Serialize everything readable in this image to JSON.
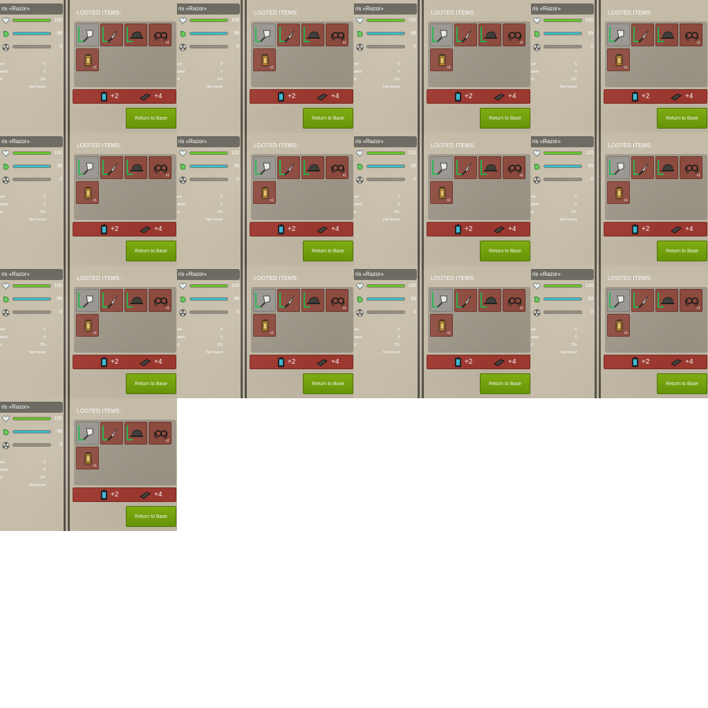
{
  "frames": 13,
  "character": {
    "name": "ris «Razor»",
    "stats": [
      {
        "icon": "heart-icon",
        "value": "100",
        "level": 1.0,
        "color": "#5fc41f"
      },
      {
        "icon": "stomach-icon",
        "value": "99",
        "level": 0.99,
        "color": "#2fb8c8"
      },
      {
        "icon": "radiation-icon",
        "value": "0",
        "level": 0.0,
        "color": "#9a9384"
      }
    ],
    "info": [
      {
        "label": "ed:",
        "value": "0"
      },
      {
        "label": "ated:",
        "value": "0"
      },
      {
        "label": "d:",
        "value": "2%"
      },
      {
        "label": ":",
        "value": "Not found"
      }
    ]
  },
  "loot": {
    "title": "LOOTED ITEMS:",
    "items": [
      {
        "icon": "cleaver-icon",
        "qty": "",
        "highlight": true,
        "new": true
      },
      {
        "icon": "knife-icon",
        "qty": "",
        "highlight": false,
        "new": true
      },
      {
        "icon": "cap-icon",
        "qty": "",
        "highlight": false,
        "new": true
      },
      {
        "icon": "goggles-icon",
        "qty": "x1",
        "highlight": false,
        "new": false
      },
      {
        "icon": "lantern-icon",
        "qty": "x1",
        "highlight": false,
        "new": false
      }
    ],
    "resources": [
      {
        "icon": "battery-icon",
        "amount": "+2"
      },
      {
        "icon": "brick-icon",
        "amount": "+4"
      }
    ],
    "return_button": "Return to Base"
  },
  "colors": {
    "accent_green": "#7cab0f",
    "slot_red": "#8e4a3e",
    "resource_bar": "#a23a31",
    "new_marker": "#22b34a"
  }
}
